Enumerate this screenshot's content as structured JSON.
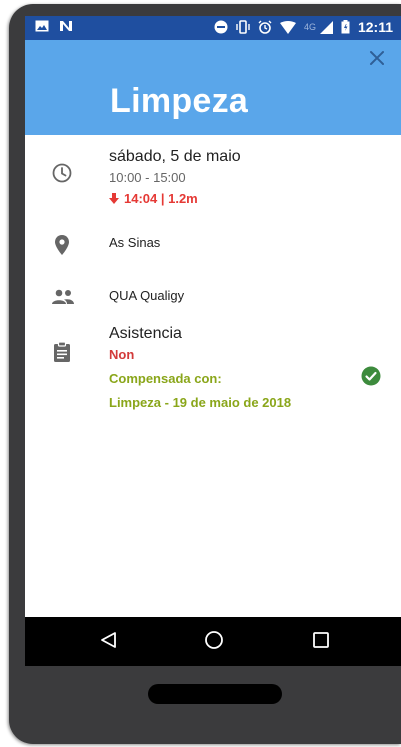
{
  "status_bar": {
    "time": "12:11",
    "network": "4G",
    "left_icons": [
      "gallery-icon",
      "notification-n-icon"
    ],
    "right_icons": [
      "do-not-disturb-icon",
      "vibrate-icon",
      "alarm-icon",
      "wifi-icon",
      "signal-icon",
      "battery-icon"
    ]
  },
  "header": {
    "title": "Limpeza",
    "close_icon": "close-icon",
    "background": "#5aa6ea"
  },
  "event": {
    "date": "sábado, 5 de maio",
    "time_range": "10:00 - 15:00",
    "arrival": "14:04 | 1.2m",
    "location": "As Sinas",
    "group": "QUA Qualigy",
    "attendance": {
      "label": "Asistencia",
      "status": "Non",
      "compensated_label": "Compensada con:",
      "compensated_event": "Limpeza - 19 de maio de 2018"
    }
  },
  "colors": {
    "accent": "#5aa6ea",
    "status_bar": "#1f4fa0",
    "red": "#e53935",
    "green": "#8aa61a",
    "check": "#3d8b3d"
  },
  "nav": {
    "back_icon": "back-triangle-icon",
    "home_icon": "home-circle-icon",
    "recents_icon": "recents-square-icon"
  }
}
